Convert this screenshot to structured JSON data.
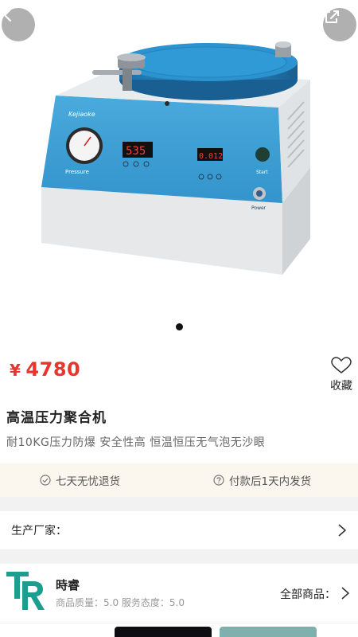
{
  "hero": {
    "image_alt": "product-photo",
    "device_brand": "Kejiaoke",
    "display_left": "535",
    "display_right": "0.012",
    "pressure_label": "Pressure",
    "start_label": "Start",
    "power_label": "Power",
    "carousel_pages": 1,
    "carousel_active": 1
  },
  "product": {
    "price_symbol": "¥",
    "price": "4780",
    "favorite_label": "收藏",
    "title": "高温压力聚合机",
    "subtitle": "耐10KG压力防爆 安全性高 恒温恒压无气泡无沙眼"
  },
  "services": [
    {
      "icon": "check-circle-icon",
      "label": "七天无忧退货"
    },
    {
      "icon": "question-circle-icon",
      "label": "付款后1天内发货"
    }
  ],
  "maker": {
    "label": "生产厂家："
  },
  "shop": {
    "name": "時睿",
    "rating": "商品质量：5.0  服务态度：5.0",
    "all_goods": "全部商品："
  },
  "colors": {
    "price_red": "#e8362e",
    "service_bg": "#fcf7ee",
    "machine_blue": "#3a9fd6",
    "logo_teal": "#1b9e8f"
  }
}
